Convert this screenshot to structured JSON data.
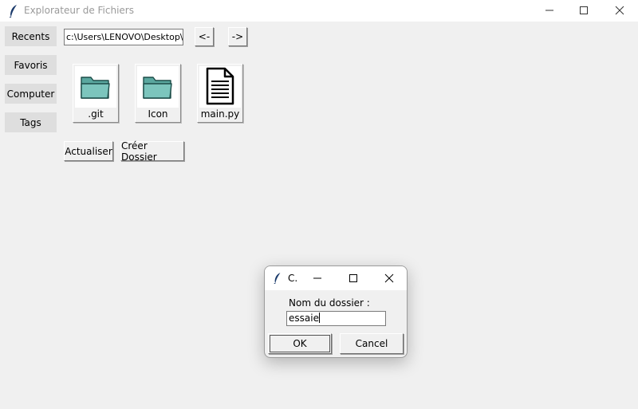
{
  "window": {
    "title": "Explorateur de Fichiers"
  },
  "sidebar": {
    "items": [
      {
        "label": "Recents"
      },
      {
        "label": "Favoris"
      },
      {
        "label": "Computer"
      },
      {
        "label": "Tags"
      }
    ]
  },
  "toolbar": {
    "path_value": "c:\\Users\\LENOVO\\Desktop\\",
    "back_label": "<-",
    "forward_label": "->"
  },
  "files": [
    {
      "name": ".git",
      "icon": "folder-icon"
    },
    {
      "name": "Icon",
      "icon": "folder-icon"
    },
    {
      "name": "main.py",
      "icon": "document-icon"
    }
  ],
  "actions": {
    "refresh_label": "Actualiser",
    "create_folder_label": "Créer Dossier"
  },
  "dialog": {
    "title": "C.",
    "prompt_label": "Nom du dossier :",
    "input_value": "essaie",
    "ok_label": "OK",
    "cancel_label": "Cancel"
  },
  "colors": {
    "folder_fill": "#7cc5bd",
    "window_bg": "#f0f0f0",
    "sidebar_button_bg": "#dedede"
  }
}
